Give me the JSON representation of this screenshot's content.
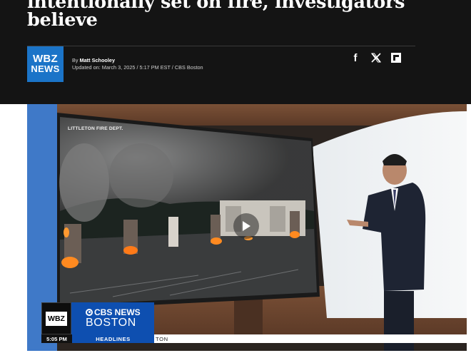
{
  "article": {
    "headline_lines": [
      "intentionally set on fire, investigators",
      "believe"
    ],
    "byline_prefix": "By",
    "author": "Matt Schooley",
    "updated": "Updated on: March 3, 2025 / 5:17 PM EST / CBS Boston"
  },
  "logo": {
    "line1": "WBZ",
    "line2": "NEWS"
  },
  "social": {
    "facebook_glyph": "f",
    "icons": [
      "facebook-icon",
      "x-icon",
      "flipboard-icon"
    ]
  },
  "video": {
    "screen_label": "LITTLETON FIRE DEPT.",
    "play_icon": "play-icon",
    "lower_third": {
      "station": "WBZ",
      "network_top": "CBS NEWS",
      "network_bottom": "BOSTON",
      "time": "5:05 PM",
      "section": "HEADLINES",
      "ticker": "TON"
    }
  },
  "colors": {
    "header_bg": "#141414",
    "brand_blue": "#1b74c8",
    "cbs_blue": "#0e4fb0"
  }
}
